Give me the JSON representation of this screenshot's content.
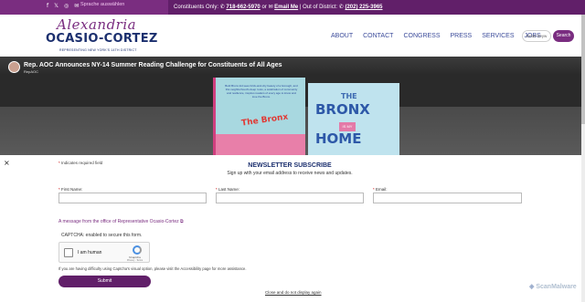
{
  "topbar": {
    "social_icons": [
      "facebook-icon",
      "x-icon",
      "instagram-icon",
      "email-icon"
    ],
    "language": "Sprache auswählen",
    "constituents_label": "Constituents Only:",
    "constituents_phone": "718-662-5970",
    "or": "or",
    "email_label": "Email Me",
    "out_of_district": "| Out of District:",
    "district_phone": "(202) 225-3965"
  },
  "header": {
    "logo_script": "Alexandria",
    "logo_name": "OCASIO-CORTEZ",
    "logo_tagline": "REPRESENTING NEW YORK'S 14TH DISTRICT",
    "nav": [
      "ABOUT",
      "CONTACT",
      "CONGRESS",
      "PRESS",
      "SERVICES",
      "JOBS"
    ],
    "search_placeholder": "Enter keyw",
    "search_button": "Search"
  },
  "video": {
    "title": "Rep. AOC Announces NY-14 Summer Reading Challenge for Constituents of All Ages",
    "channel": "RepAOC",
    "book1_text": "Bold Bronx kid sees brick-and-city beauty of a borough, and this neighborhood's deep roots, a celebration of community and resilience, inspires readers of every age to know and love the Bronx.",
    "book1_title": "The Bronx",
    "book2_the": "THE",
    "book2_bronx": "BRONX",
    "book2_is_my": "IS MY",
    "book2_home": "HOME"
  },
  "newsletter": {
    "close": "×",
    "required_star": "*",
    "required_note": "Indicates required field",
    "title": "NEWSLETTER SUBSCRIBE",
    "subtitle": "Sign up with your email address to receive news and updates.",
    "first_name_label": "First Name:",
    "last_name_label": "Last Name:",
    "email_label": "Email:",
    "message": "A message from the office of Representative Ocasio-Cortez",
    "captcha_note": "CAPTCHA: enabled to secure this form.",
    "captcha_label": "I am human",
    "captcha_brand": "hCaptcha",
    "captcha_terms": "Privacy - Terms",
    "access_note": "If you are having difficulty using Captcha's visual option, please visit the Accessibility page for more assistance.",
    "submit": "Submit",
    "close_link": "Close and do not display again"
  },
  "watermark": "ScanMalware",
  "colors": {
    "brand_purple": "#611f69",
    "accent_purple": "#7a2d80",
    "navy": "#1b2f6e"
  }
}
